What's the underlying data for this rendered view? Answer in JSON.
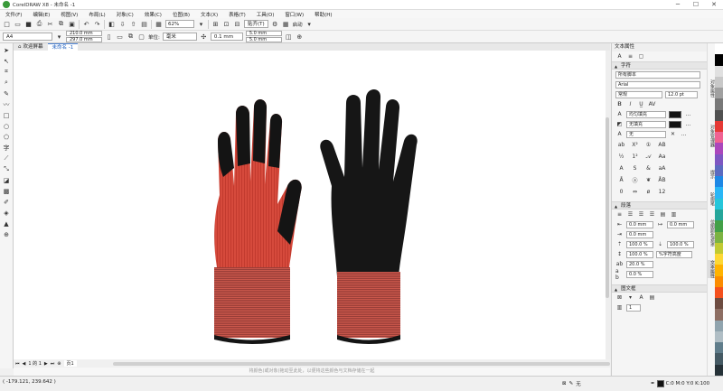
{
  "window": {
    "title": "CorelDRAW X8 - 未命名 -1"
  },
  "menu": [
    "文件(F)",
    "编辑(E)",
    "视图(V)",
    "布局(L)",
    "对象(C)",
    "效果(C)",
    "位图(B)",
    "文本(X)",
    "表格(T)",
    "工具(O)",
    "窗口(W)",
    "帮助(H)"
  ],
  "toolbar": {
    "zoom": "62%",
    "snap_label": "贴齐(T)",
    "launch_label": "启动"
  },
  "propbar": {
    "page_size": "A4",
    "width": "210.0 mm",
    "height": "297.0 mm",
    "units_label": "单位:",
    "units": "毫米",
    "nudge": "0.1 mm",
    "dup_x": "5.0 mm",
    "dup_y": "5.0 mm"
  },
  "tabs": [
    {
      "label": "欢迎屏幕"
    },
    {
      "label": "未命名 -1"
    }
  ],
  "pagebar": {
    "page_of": "1 的 1",
    "page_tab": "页1"
  },
  "hint": "将颜色(或对象)拖动至此处，以便将这些颜色与文档存储在一起",
  "status": {
    "coords": "( -179.121, 239.642 )",
    "fill_none": "无",
    "cmyk": "C:0 M:0 Y:0 K:100"
  },
  "panel": {
    "title": "文本属性",
    "char_section": "字符",
    "script": "所有脚本",
    "font": "Arial",
    "style": "常规",
    "size": "12.0 pt",
    "fill_type": "均匀填充",
    "bg_fill": "无填充",
    "outline": "无",
    "para_section": "段落",
    "indent1": "0.0 mm",
    "indent2": "0.0 mm",
    "indent3": "0.0 mm",
    "spacing1": "100.0 %",
    "spacing2": "100.0 %",
    "spacing3": "100.0 %",
    "spacing_mode": "%字符高度",
    "spacing4": "20.0 %",
    "spacing5": "0.0 %",
    "frame_section": "图文框",
    "columns": "1"
  },
  "side_tabs": [
    "对象属性",
    "对象管理器",
    "提示",
    "轮廓笔",
    "位图颜色遮罩",
    "文本属性"
  ],
  "colors": {
    "accent": "#2060c0",
    "palette": [
      "#ffffff",
      "#000000",
      "#e0e0e0",
      "#c8c8c8",
      "#a0a0a0",
      "#787878",
      "#505050",
      "#e53935",
      "#f06292",
      "#ab47bc",
      "#7e57c2",
      "#5c6bc0",
      "#1e88e5",
      "#29b6f6",
      "#26c6da",
      "#26a69a",
      "#43a047",
      "#7cb342",
      "#c0ca33",
      "#fdd835",
      "#ffb300",
      "#fb8c00",
      "#f4511e",
      "#6d4c41",
      "#8d6e63",
      "#90a4ae",
      "#b0bec5",
      "#607d8b",
      "#455a64",
      "#263238"
    ]
  }
}
